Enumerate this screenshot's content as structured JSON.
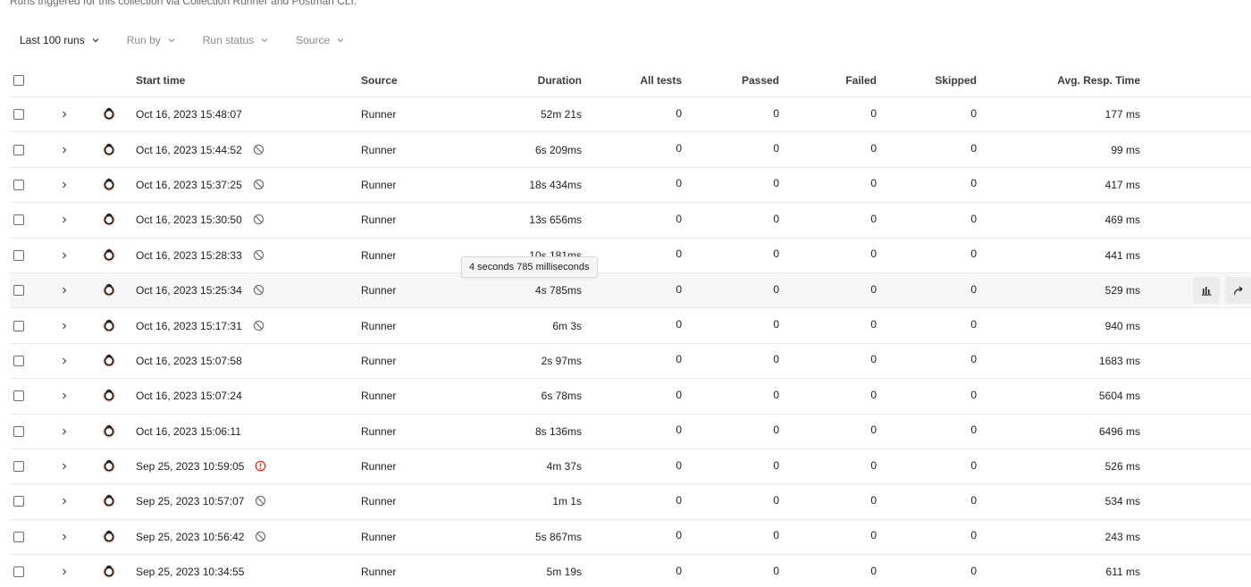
{
  "header": {
    "subtitle": "Runs triggered for this collection via Collection Runner and Postman CLI."
  },
  "filters": [
    {
      "label": "Last 100 runs",
      "active": true
    },
    {
      "label": "Run by",
      "active": false
    },
    {
      "label": "Run status",
      "active": false
    },
    {
      "label": "Source",
      "active": false
    }
  ],
  "table": {
    "columns": {
      "start_time": "Start time",
      "source": "Source",
      "duration": "Duration",
      "all_tests": "All tests",
      "passed": "Passed",
      "failed": "Failed",
      "skipped": "Skipped",
      "avg_resp": "Avg. Resp. Time"
    },
    "rows": [
      {
        "start": "Oct 16, 2023 15:48:07",
        "status": "none",
        "source": "Runner",
        "duration": "52m 21s",
        "all": "0",
        "passed": "0",
        "failed": "0",
        "skipped": "0",
        "avg": "177 ms"
      },
      {
        "start": "Oct 16, 2023 15:44:52",
        "status": "stopped",
        "source": "Runner",
        "duration": "6s 209ms",
        "all": "0",
        "passed": "0",
        "failed": "0",
        "skipped": "0",
        "avg": "99 ms"
      },
      {
        "start": "Oct 16, 2023 15:37:25",
        "status": "stopped",
        "source": "Runner",
        "duration": "18s 434ms",
        "all": "0",
        "passed": "0",
        "failed": "0",
        "skipped": "0",
        "avg": "417 ms"
      },
      {
        "start": "Oct 16, 2023 15:30:50",
        "status": "stopped",
        "source": "Runner",
        "duration": "13s 656ms",
        "all": "0",
        "passed": "0",
        "failed": "0",
        "skipped": "0",
        "avg": "469 ms"
      },
      {
        "start": "Oct 16, 2023 15:28:33",
        "status": "stopped",
        "source": "Runner",
        "duration": "10s 181ms",
        "all": "0",
        "passed": "0",
        "failed": "0",
        "skipped": "0",
        "avg": "441 ms"
      },
      {
        "start": "Oct 16, 2023 15:25:34",
        "status": "stopped",
        "source": "Runner",
        "duration": "4s 785ms",
        "all": "0",
        "passed": "0",
        "failed": "0",
        "skipped": "0",
        "avg": "529 ms"
      },
      {
        "start": "Oct 16, 2023 15:17:31",
        "status": "stopped",
        "source": "Runner",
        "duration": "6m 3s",
        "all": "0",
        "passed": "0",
        "failed": "0",
        "skipped": "0",
        "avg": "940 ms"
      },
      {
        "start": "Oct 16, 2023 15:07:58",
        "status": "none",
        "source": "Runner",
        "duration": "2s 97ms",
        "all": "0",
        "passed": "0",
        "failed": "0",
        "skipped": "0",
        "avg": "1683 ms"
      },
      {
        "start": "Oct 16, 2023 15:07:24",
        "status": "none",
        "source": "Runner",
        "duration": "6s 78ms",
        "all": "0",
        "passed": "0",
        "failed": "0",
        "skipped": "0",
        "avg": "5604 ms"
      },
      {
        "start": "Oct 16, 2023 15:06:11",
        "status": "none",
        "source": "Runner",
        "duration": "8s 136ms",
        "all": "0",
        "passed": "0",
        "failed": "0",
        "skipped": "0",
        "avg": "6496 ms"
      },
      {
        "start": "Sep 25, 2023 10:59:05",
        "status": "error",
        "source": "Runner",
        "duration": "4m 37s",
        "all": "0",
        "passed": "0",
        "failed": "0",
        "skipped": "0",
        "avg": "526 ms"
      },
      {
        "start": "Sep 25, 2023 10:57:07",
        "status": "stopped",
        "source": "Runner",
        "duration": "1m 1s",
        "all": "0",
        "passed": "0",
        "failed": "0",
        "skipped": "0",
        "avg": "534 ms"
      },
      {
        "start": "Sep 25, 2023 10:56:42",
        "status": "stopped",
        "source": "Runner",
        "duration": "5s 867ms",
        "all": "0",
        "passed": "0",
        "failed": "0",
        "skipped": "0",
        "avg": "243 ms"
      },
      {
        "start": "Sep 25, 2023 10:34:55",
        "status": "none",
        "source": "Runner",
        "duration": "5m 19s",
        "all": "0",
        "passed": "0",
        "failed": "0",
        "skipped": "0",
        "avg": "611 ms"
      }
    ],
    "hover_row_index": 5
  },
  "tooltip": {
    "text": "4 seconds 785 milliseconds"
  },
  "icons": {
    "runner": "runner-icon",
    "expand": "chevron-right-icon",
    "stopped": "stopped-icon",
    "error": "error-icon",
    "filter_chevron": "chevron-down-icon",
    "chart": "bar-chart-icon",
    "share": "share-icon"
  },
  "colors": {
    "runner_icon": "#ff6c37",
    "error": "#eb2013",
    "stopped": "#6b6b6b",
    "hover_bg": "#f7f7f7",
    "border": "#ebebeb"
  }
}
